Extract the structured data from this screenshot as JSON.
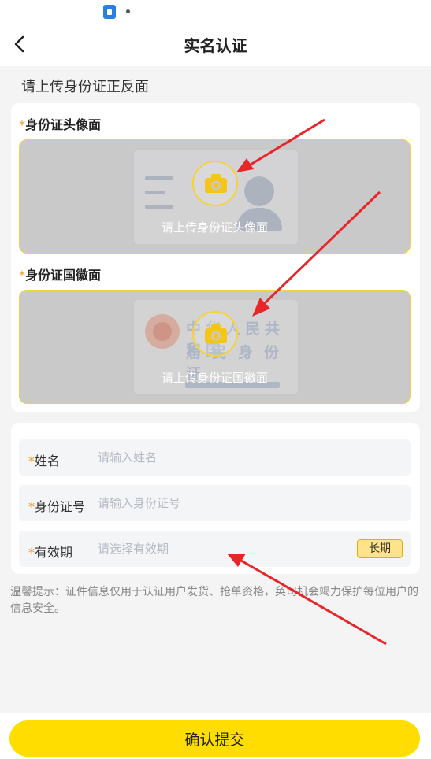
{
  "status_bar": {
    "app_icon": "notification-app-icon",
    "dot_icon": "notification-dot-icon"
  },
  "nav": {
    "title": "实名认证",
    "back_icon": "chevron-left-icon"
  },
  "upload_section": {
    "heading": "请上传身份证正反面",
    "front": {
      "required_mark": "*",
      "label": "身份证头像面",
      "hint": "请上传身份证头像面",
      "icon": "camera-icon"
    },
    "back": {
      "required_mark": "*",
      "label": "身份证国徽面",
      "hint": "请上传身份证国徽面",
      "icon": "camera-icon",
      "card_text_line1": "中华人民共和国",
      "card_text_line2": "居民身份证"
    }
  },
  "form": {
    "name": {
      "required_mark": "*",
      "label": "姓名",
      "placeholder": "请输入姓名",
      "value": ""
    },
    "id_number": {
      "required_mark": "*",
      "label": "身份证号",
      "placeholder": "请输入身份证号",
      "value": ""
    },
    "validity": {
      "required_mark": "*",
      "label": "有效期",
      "placeholder": "请选择有效期",
      "value": "",
      "long_term_label": "长期"
    }
  },
  "notice": "温馨提示：证件信息仅用于认证用户发货、抢单资格，奂司机会竭力保护每位用户的信息安全。",
  "footer": {
    "submit_label": "确认提交"
  },
  "colors": {
    "accent": "#ffdd00",
    "required": "#f39a1e",
    "annotation_arrow": "#e8262a"
  }
}
